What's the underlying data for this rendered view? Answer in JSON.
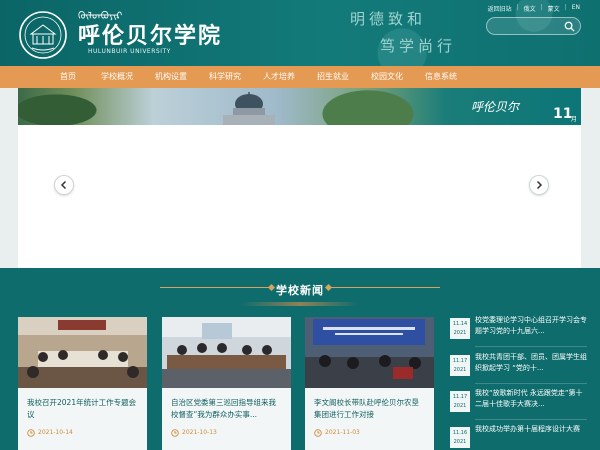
{
  "header": {
    "logo_mongolian": "ᠬᠥᠯᠦᠨᠪᠦᠶᠢᠷ",
    "logo_cn": "呼伦贝尔学院",
    "logo_en": "HULUNBUIR UNIVERSITY",
    "slogan_1": "明德致和",
    "slogan_2": "笃学尚行",
    "top_links": [
      "返回旧站",
      "俄文",
      "蒙文",
      "EN"
    ],
    "search_placeholder": ""
  },
  "nav": {
    "items": [
      "首页",
      "学校概况",
      "机构设置",
      "科学研究",
      "人才培养",
      "招生就业",
      "校园文化",
      "信息系统"
    ]
  },
  "banner": {
    "brand_mark": "呼伦贝尔",
    "day": "11",
    "month": "月"
  },
  "news": {
    "section_title": "学校新闻",
    "cards": [
      {
        "caption": "我校召开2021年统计工作专题会议",
        "date": "2021-10-14"
      },
      {
        "caption": "自治区党委第三巡回指导组来我校督查“我为群众办实事...",
        "date": "2021-10-13"
      },
      {
        "caption": "李文阁校长带队赴呼伦贝尔农垦集团进行工作对接",
        "date": "2021-11-03"
      }
    ],
    "side": [
      {
        "md": "11.14",
        "yr": "2021",
        "text": "校党委理论学习中心组召开学习会专题学习党的十九届六..."
      },
      {
        "md": "11.17",
        "yr": "2021",
        "text": "我校共青团干部、团员、团属学生组织掀起学习 “党的十..."
      },
      {
        "md": "11.17",
        "yr": "2021",
        "text": "我校“放歌新时代 永远跟党走”第十二届十佳歌手大赛决..."
      },
      {
        "md": "11.16",
        "yr": "2021",
        "text": "我校成功举办第十届程序设计大赛"
      }
    ]
  },
  "colors": {
    "teal": "#0f6c6d",
    "nav_orange": "#e49a52",
    "accent_gold": "#d7a35f"
  }
}
